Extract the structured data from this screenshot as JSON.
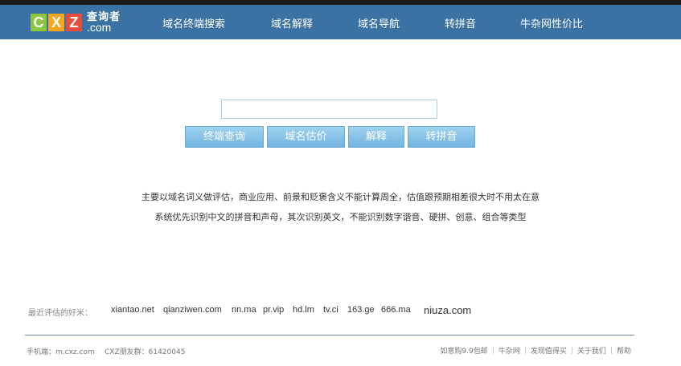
{
  "logo": {
    "letters": [
      "C",
      "X",
      "Z"
    ],
    "text_cn": "查询者",
    "text_com": ".com"
  },
  "nav": {
    "items": [
      {
        "label": "域名终端搜索"
      },
      {
        "label": "域名解释"
      },
      {
        "label": "域名导航"
      },
      {
        "label": "转拼音"
      },
      {
        "label": "牛杂网性价比"
      }
    ]
  },
  "search": {
    "value": "",
    "placeholder": ""
  },
  "buttons": {
    "terminal": "终端查询",
    "estimate": "域名估价",
    "explain": "解释",
    "pinyin": "转拼音"
  },
  "description": {
    "line1": "主要以域名词义做评估，商业应用、前景和贬褒含义不能计算周全，估值跟预期相差很大时不用太在意",
    "line2": "系统优先识别中文的拼音和声母，其次识别英文，不能识别数字谐音、硬拼、创意、组合等类型"
  },
  "recent": {
    "label": "最近评估的好米：",
    "domains": [
      "xiantao.net",
      "qianziwen.com",
      "nn.ma",
      "pr.vip",
      "hd.lm",
      "tv.ci",
      "163.ge",
      "666.ma",
      "niuza.com"
    ]
  },
  "footer": {
    "mobile": "手机端：m.cxz.com",
    "qq_group": "CXZ朋友群：61420045",
    "links": [
      "如意购9.9包邮",
      "牛杂网",
      "发现值得买",
      "关于我们",
      "帮助"
    ]
  }
}
